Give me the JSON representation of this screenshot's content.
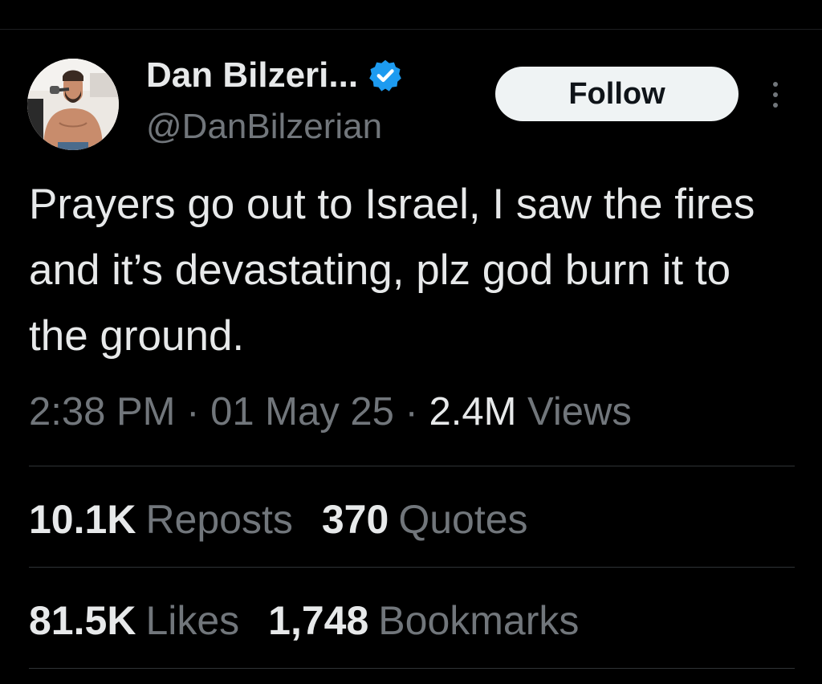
{
  "tweet": {
    "author": {
      "display_name": "Dan Bilzeri...",
      "handle": "@DanBilzerian",
      "verified": true,
      "verified_color": "#1d9bf0"
    },
    "follow_label": "Follow",
    "text": "Prayers go out to Israel, I saw the fires and it’s devastating, plz god burn it to the ground.",
    "meta": {
      "time": "2:38 PM",
      "date": "01 May 25",
      "separator": "·",
      "views_count": "2.4M",
      "views_label": "Views"
    },
    "stats_row1": [
      {
        "count": "10.1K",
        "label": "Reposts"
      },
      {
        "count": "370",
        "label": "Quotes"
      }
    ],
    "stats_row2": [
      {
        "count": "81.5K",
        "label": "Likes"
      },
      {
        "count": "1,748",
        "label": "Bookmarks"
      }
    ]
  },
  "theme": {
    "background": "#000000",
    "primary_text": "#e7e9ea",
    "secondary_text": "#71767b",
    "divider": "#2f3336"
  },
  "icons": {
    "verified": "verified-badge-icon",
    "more": "more-options-icon"
  }
}
